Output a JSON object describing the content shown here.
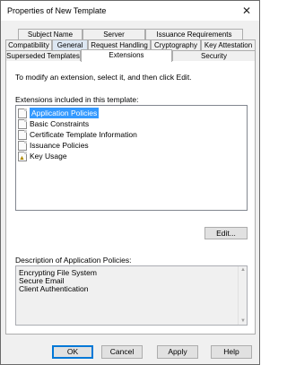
{
  "window": {
    "title": "Properties of New Template",
    "close_glyph": "✕"
  },
  "tabs": {
    "row1": [
      "Subject Name",
      "Server",
      "Issuance Requirements"
    ],
    "row2": [
      "Compatibility",
      "General",
      "Request Handling",
      "Cryptography",
      "Key Attestation"
    ],
    "row3": [
      "Superseded Templates",
      "Extensions",
      "Security"
    ],
    "selected": "Extensions"
  },
  "extensions": {
    "instructions": "To modify an extension, select it, and then click Edit.",
    "list_label": "Extensions included in this template:",
    "items": [
      {
        "label": "Application Policies",
        "icon": "certificate-icon",
        "selected": true
      },
      {
        "label": "Basic Constraints",
        "icon": "certificate-icon"
      },
      {
        "label": "Certificate Template Information",
        "icon": "certificate-icon"
      },
      {
        "label": "Issuance Policies",
        "icon": "certificate-icon"
      },
      {
        "label": "Key Usage",
        "icon": "critical-certificate-icon"
      }
    ],
    "edit_button": "Edit..."
  },
  "description": {
    "label": "Description of Application Policies:",
    "lines": [
      "Encrypting File System",
      "Secure Email",
      "Client Authentication"
    ]
  },
  "buttons": {
    "ok": "OK",
    "cancel": "Cancel",
    "apply": "Apply",
    "help": "Help"
  },
  "colors": {
    "selection": "#3399ff",
    "default_button_border": "#0078d7"
  }
}
